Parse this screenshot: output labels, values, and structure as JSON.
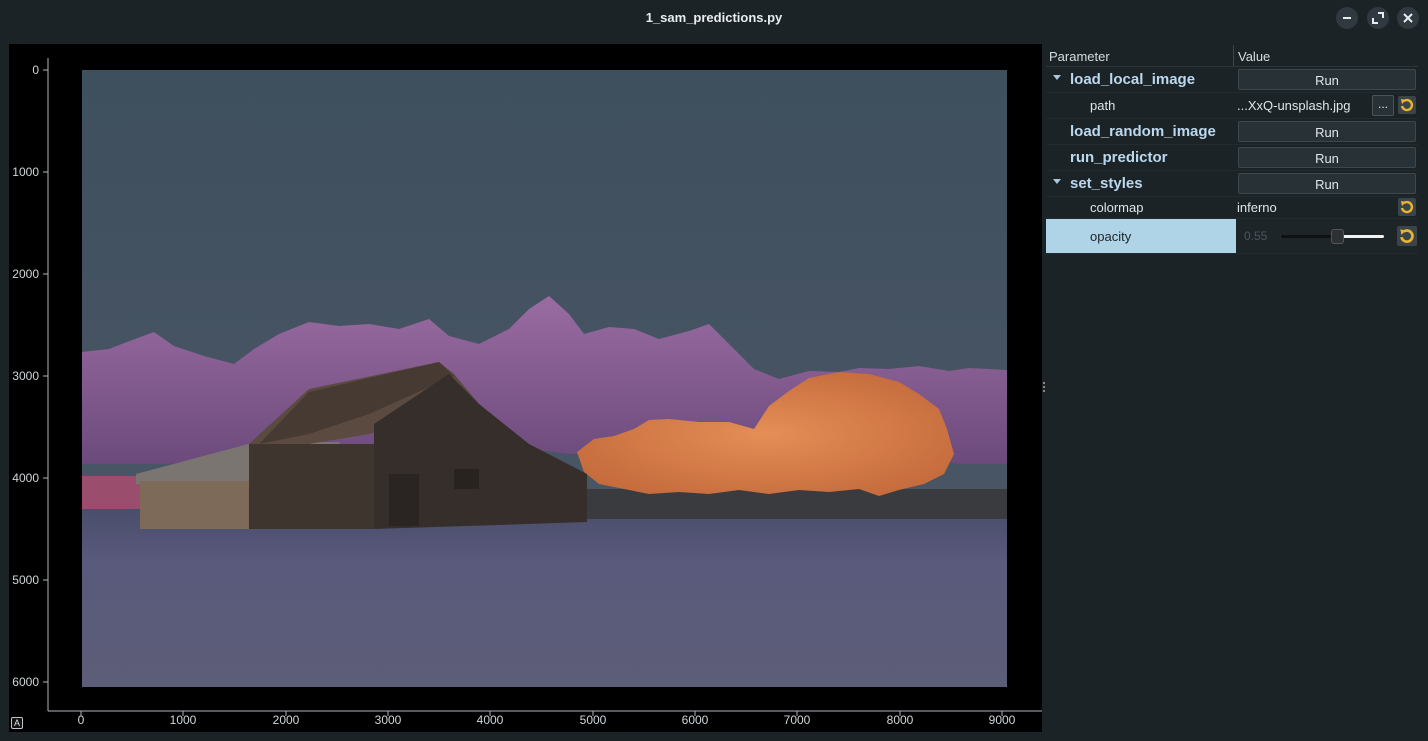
{
  "window": {
    "title": "1_sam_predictions.py"
  },
  "plot": {
    "y_ticks": [
      "0",
      "1000",
      "2000",
      "3000",
      "4000",
      "5000",
      "6000"
    ],
    "x_ticks": [
      "0",
      "1000",
      "2000",
      "3000",
      "4000",
      "5000",
      "6000",
      "7000",
      "8000",
      "9000"
    ],
    "autoscale_label": "A"
  },
  "tree": {
    "header_param": "Parameter",
    "header_value": "Value",
    "rows": [
      {
        "name": "load_local_image",
        "button": "Run"
      },
      {
        "name": "path",
        "value": "...XxQ-unsplash.jpg",
        "browse": "..."
      },
      {
        "name": "load_random_image",
        "button": "Run"
      },
      {
        "name": "run_predictor",
        "button": "Run"
      },
      {
        "name": "set_styles",
        "button": "Run"
      },
      {
        "name": "colormap",
        "value": "inferno"
      },
      {
        "name": "opacity",
        "value": "0.55",
        "fraction": 0.55
      }
    ]
  },
  "colors": {
    "selection": "#b0d4e7",
    "accent": "#bcd8ee"
  }
}
